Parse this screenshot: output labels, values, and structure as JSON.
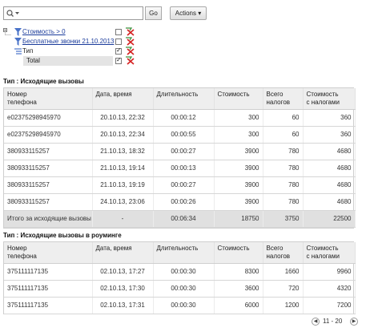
{
  "toolbar": {
    "search_value": "",
    "go_label": "Go",
    "actions_label": "Actions ▾"
  },
  "filters": [
    {
      "label": "Стоимость > 0",
      "checked": false
    },
    {
      "label": "Бесплатные звонки 21.10.2013",
      "checked": false
    },
    {
      "label": "Тип",
      "checked": true
    },
    {
      "label": "Total",
      "checked": true
    }
  ],
  "sections": [
    {
      "title": "Тип : Исходящие вызовы",
      "columns": [
        "Номер\nтелефона",
        "Дата, время",
        "Длительность",
        "Стоимость",
        "Всего\nналогов",
        "Стоимость\nс налогами"
      ],
      "rows": [
        [
          "e02375298945970",
          "20.10.13, 22:32",
          "00:00:12",
          "300",
          "60",
          "360"
        ],
        [
          "e02375298945970",
          "20.10.13, 22:34",
          "00:00:55",
          "300",
          "60",
          "360"
        ],
        [
          "380933115257",
          "21.10.13, 18:32",
          "00:00:27",
          "3900",
          "780",
          "4680"
        ],
        [
          "380933115257",
          "21.10.13, 19:14",
          "00:00:13",
          "3900",
          "780",
          "4680"
        ],
        [
          "380933115257",
          "21.10.13, 19:19",
          "00:00:27",
          "3900",
          "780",
          "4680"
        ],
        [
          "380933115257",
          "24.10.13, 23:06",
          "00:00:26",
          "3900",
          "780",
          "4680"
        ]
      ],
      "summary": [
        "Итого за исходящие вызовы",
        "-",
        "00:06:34",
        "18750",
        "3750",
        "22500"
      ]
    },
    {
      "title": "Тип : Исходящие вызовы в роуминге",
      "columns": [
        "Номер\nтелефона",
        "Дата, время",
        "Длительность",
        "Стоимость",
        "Всего\nналогов",
        "Стоимость\nс налогами"
      ],
      "rows": [
        [
          "375111117135",
          "02.10.13, 17:27",
          "00:00:30",
          "8300",
          "1660",
          "9960"
        ],
        [
          "375111117135",
          "02.10.13, 17:30",
          "00:00:30",
          "3600",
          "720",
          "4320"
        ],
        [
          "375111117135",
          "02.10.13, 17:31",
          "00:00:30",
          "6000",
          "1200",
          "7200"
        ]
      ]
    }
  ],
  "pager": {
    "range": "11 - 20"
  },
  "colors": {
    "link": "#1a3b9b",
    "header_bg": "#eeeeee",
    "summary_bg": "#e0e0e0"
  }
}
